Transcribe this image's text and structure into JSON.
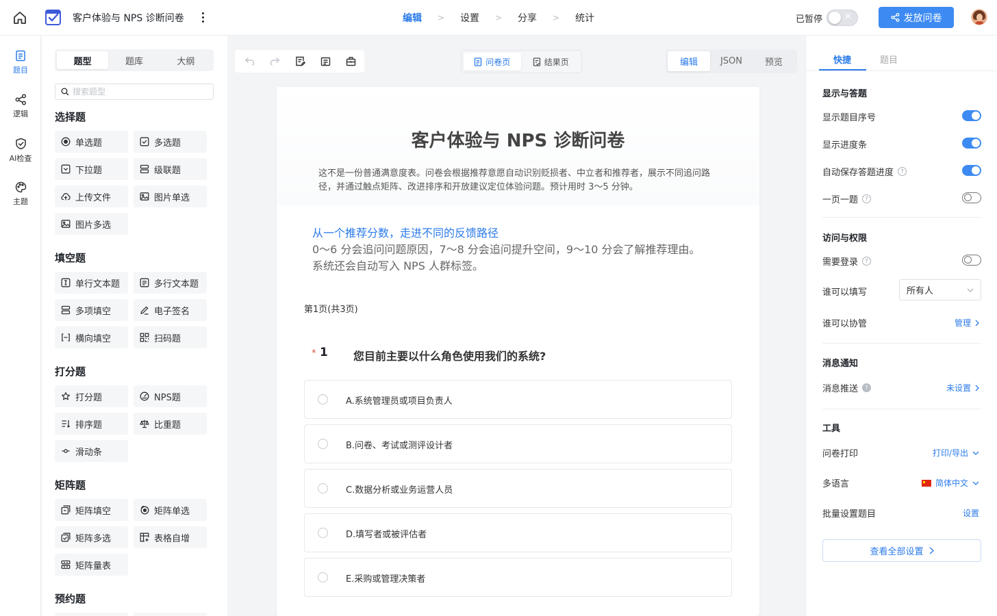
{
  "header": {
    "doc_title": "客户体验与 NPS 诊断问卷",
    "steps": [
      "编辑",
      "设置",
      "分享",
      "统计"
    ],
    "active_step": "编辑",
    "paused_label": "已暂停",
    "publish_label": "发放问卷"
  },
  "rail": {
    "items": [
      {
        "label": "题目",
        "icon": "document-icon",
        "active": true
      },
      {
        "label": "逻辑",
        "icon": "share-nodes-icon",
        "active": false
      },
      {
        "label": "AI检查",
        "icon": "shield-check-icon",
        "active": false
      },
      {
        "label": "主题",
        "icon": "palette-icon",
        "active": false
      }
    ]
  },
  "panel": {
    "tabs": [
      "题型",
      "题库",
      "大纲"
    ],
    "active_tab": "题型",
    "search_placeholder": "搜索题型",
    "groups": [
      {
        "title": "选择题",
        "items": [
          "单选题",
          "多选题",
          "下拉题",
          "级联题",
          "上传文件",
          "图片单选",
          "图片多选"
        ]
      },
      {
        "title": "填空题",
        "items": [
          "单行文本题",
          "多行文本题",
          "多项填空",
          "电子签名",
          "横向填空",
          "扫码题"
        ]
      },
      {
        "title": "打分题",
        "items": [
          "打分题",
          "NPS题",
          "排序题",
          "比重题",
          "滑动条"
        ]
      },
      {
        "title": "矩阵题",
        "items": [
          "矩阵填空",
          "矩阵单选",
          "矩阵多选",
          "表格自增",
          "矩阵量表"
        ]
      },
      {
        "title": "预约题",
        "items": []
      }
    ]
  },
  "canvas": {
    "page_tabs": [
      "问卷页",
      "结果页"
    ],
    "active_page_tab": "问卷页",
    "mode_tabs": [
      "编辑",
      "JSON",
      "预览"
    ],
    "active_mode": "编辑",
    "survey": {
      "title": "客户体验与 NPS 诊断问卷",
      "description": "这不是一份普通满意度表。问卷会根据推荐意愿自动识别贬损者、中立者和推荐者，展示不同追问路径，并通过触点矩阵、改进排序和开放建议定位体验问题。预计用时 3～5 分钟。",
      "intro_title": "从一个推荐分数，走进不同的反馈路径",
      "intro_lines": [
        "0～6 分会追问问题原因，7～8 分会追问提升空间，9～10 分会了解推荐理由。",
        "系统还会自动写入 NPS 人群标签。"
      ],
      "page_info": "第1页(共3页)",
      "question": {
        "required_mark": "*",
        "number": "1",
        "text": "您目前主要以什么角色使用我们的系统?",
        "options": [
          "A.系统管理员或项目负责人",
          "B.问卷、考试或测评设计者",
          "C.数据分析或业务运营人员",
          "D.填写者或被评估者",
          "E.采购或管理决策者"
        ]
      }
    }
  },
  "settings": {
    "tabs": [
      "快捷",
      "题目"
    ],
    "active_tab": "快捷",
    "display": {
      "title": "显示与答题",
      "rows": [
        {
          "label": "显示题目序号",
          "on": true,
          "help": false
        },
        {
          "label": "显示进度条",
          "on": true,
          "help": false
        },
        {
          "label": "自动保存答题进度",
          "on": true,
          "help": true
        },
        {
          "label": "一页一题",
          "on": false,
          "help": true
        }
      ]
    },
    "access": {
      "title": "访问与权限",
      "login_label": "需要登录",
      "login_on": false,
      "who_fill_label": "谁可以填写",
      "who_fill_value": "所有人",
      "who_manage_label": "谁可以协管",
      "who_manage_link": "管理"
    },
    "notify": {
      "title": "消息通知",
      "push_label": "消息推送",
      "push_link": "未设置"
    },
    "tools": {
      "title": "工具",
      "print_label": "问卷打印",
      "print_link": "打印/导出",
      "lang_label": "多语言",
      "lang_link": "简体中文",
      "batch_label": "批量设置题目",
      "batch_link": "设置"
    },
    "all_settings_label": "查看全部设置"
  },
  "colors": {
    "accent": "#2b7be9",
    "publish_bg": "#3d8bf2",
    "required": "#e34d3d"
  }
}
